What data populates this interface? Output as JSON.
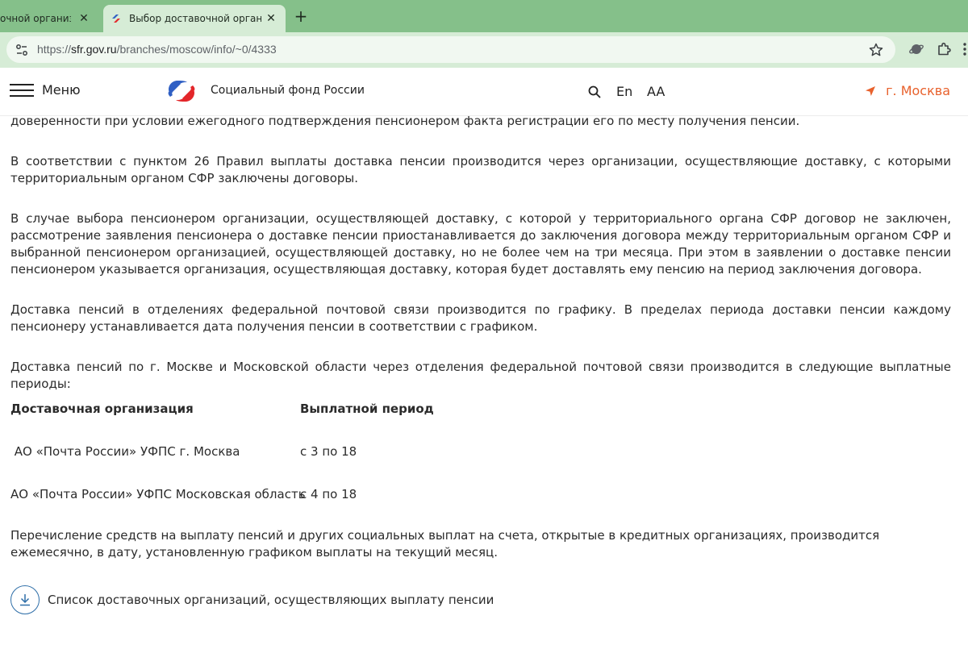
{
  "browser": {
    "tabs": [
      {
        "title": "очной организац",
        "active": false
      },
      {
        "title": "Выбор доставочной организац",
        "active": true
      }
    ],
    "new_tab_label": "+",
    "close_glyph": "✕",
    "url": {
      "scheme": "https://",
      "host": "sfr.gov.ru",
      "path": "/branches/moscow/info/~0/4333"
    }
  },
  "site": {
    "menu_label": "Меню",
    "org_name": "Социальный фонд России",
    "lang_label": "En",
    "font_size_label": "AA",
    "city_label": "г. Москва",
    "accent_color": "#e8612c",
    "logo_colors": {
      "blue": "#2f5fc4",
      "red": "#e3262a"
    }
  },
  "content": {
    "paragraphs": [
      "доверенности при условии ежегодного подтверждения пенсионером факта регистрации его по месту получения пенсии.",
      "В соответствии с пунктом 26 Правил выплаты доставка пенсии производится через организации, осуществляющие доставку, с которыми территориальным органом СФР заключены договоры.",
      "В случае выбора пенсионером организации, осуществляющей доставку, с которой у территориального органа СФР договор не заключен, рассмотрение заявления пенсионера о доставке пенсии приостанавливается до заключения договора между территориальным органом СФР и выбранной пенсионером организацией, осуществляющей доставку, но не более чем на три месяца. При этом в заявлении о доставке пенсии пенсионером указывается организация, осуществляющая доставку, которая будет доставлять ему пенсию на период заключения договора.",
      "Доставка пенсий в отделениях федеральной почтовой связи производится по графику. В пределах периода доставки пенсии каждому пенсионеру устанавливается дата получения пенсии в соответствии с графиком.",
      "Доставка пенсий по г. Москве и Московской области через отделения федеральной почтовой связи производится в следующие выплатные периоды:"
    ],
    "table": {
      "headers": [
        "Доставочная организация",
        "Выплатной период"
      ],
      "rows": [
        [
          " АО «Почта России» УФПС г. Москва",
          "с 3 по 18"
        ],
        [
          "АО «Почта России» УФПС Московская область",
          "с 4 по 18"
        ]
      ]
    },
    "final_paragraph": "Перечисление средств на выплату пенсий и других социальных выплат на счета, открытые в кредитных организациях, производится ежемесячно, в дату, установленную графиком выплаты на текущий месяц.",
    "download_link_label": "Список доставочных организаций, осуществляющих выплату пенсии"
  }
}
